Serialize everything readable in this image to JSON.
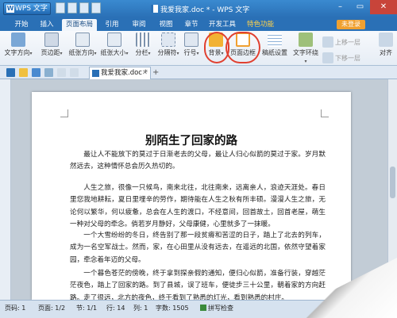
{
  "app": {
    "name": "WPS 文字",
    "window_title": "我爱我家.doc * - WPS 文字",
    "unlogged_label": "未登录"
  },
  "menu": {
    "tabs": [
      {
        "label": "开始"
      },
      {
        "label": "插入"
      },
      {
        "label": "页面布局",
        "active": true
      },
      {
        "label": "引用"
      },
      {
        "label": "审阅"
      },
      {
        "label": "视图"
      },
      {
        "label": "章节"
      },
      {
        "label": "开发工具"
      },
      {
        "label": "特色功能",
        "special": true
      }
    ]
  },
  "ribbon": {
    "text_direction": "文字方向",
    "margins": "页边距",
    "orientation": "纸张方向",
    "size": "纸张大小",
    "columns": "分栏",
    "breaks": "分隔符",
    "line_numbers": "行号",
    "background": "背景",
    "page_border": "页面边框",
    "manuscript": "稿纸设置",
    "text_wrap": "文字环绕",
    "bring_forward": "上移一层",
    "send_backward": "下移一层",
    "align": "对齐"
  },
  "doc_tab": {
    "label": "我爱我家.doc *"
  },
  "document": {
    "title": "别陌生了回家的路",
    "paragraphs": [
      "最让人不能放下的莫过于日渐老去的父母，最让人归心似箭的莫过于家。岁月默然远去，这种情怀总会历久热切的。",
      "人生之旅，很像一只候鸟，南来北往，北往南来，远离亲人，浪迹天涯处。春日里您我地耕耘，夏日里埋辛的劳作，期待能在人生之秋有所丰硕。漫漫人生之旅，无论何以繁华，何以疲惫，总会在人生的渡口，不经意间，回首故土，回首老屋，萌生一种对父母的牵念。倘若岁月静好，父母康健，心里就多了一抹暖。",
      "一个大雪纷纷的冬日，终告别了那一段贫瘠和苦涩的日子，踏上了北去的列车，成为一名空军战士。然而，家，在心田里从没有远去，在遥远的北国，依然守望着家园，牵念着年迈的父母。",
      "一个暮色苍茫的傍晚，终于拿到探亲假的通知，便归心似箭，准备行装，穿越茫茫夜色，踏上了回家的路。到了县城，误了班车，便徒步三十公里，朝着家的方向赶路。走了很远，北方的夜色，终于看到了熟悉的灯光，看到熟悉的村庄。"
    ]
  },
  "status": {
    "page": "页码: 1",
    "pages": "页面: 1/2",
    "section": "节: 1/1",
    "line": "行: 14",
    "column": "列: 1",
    "words": "字数: 1505",
    "spellcheck": "拼写检查"
  },
  "colors": {
    "title_bar": "#2a70b6",
    "highlight_circle": "#e04030",
    "ribbon_bg": "#eef3f9"
  }
}
